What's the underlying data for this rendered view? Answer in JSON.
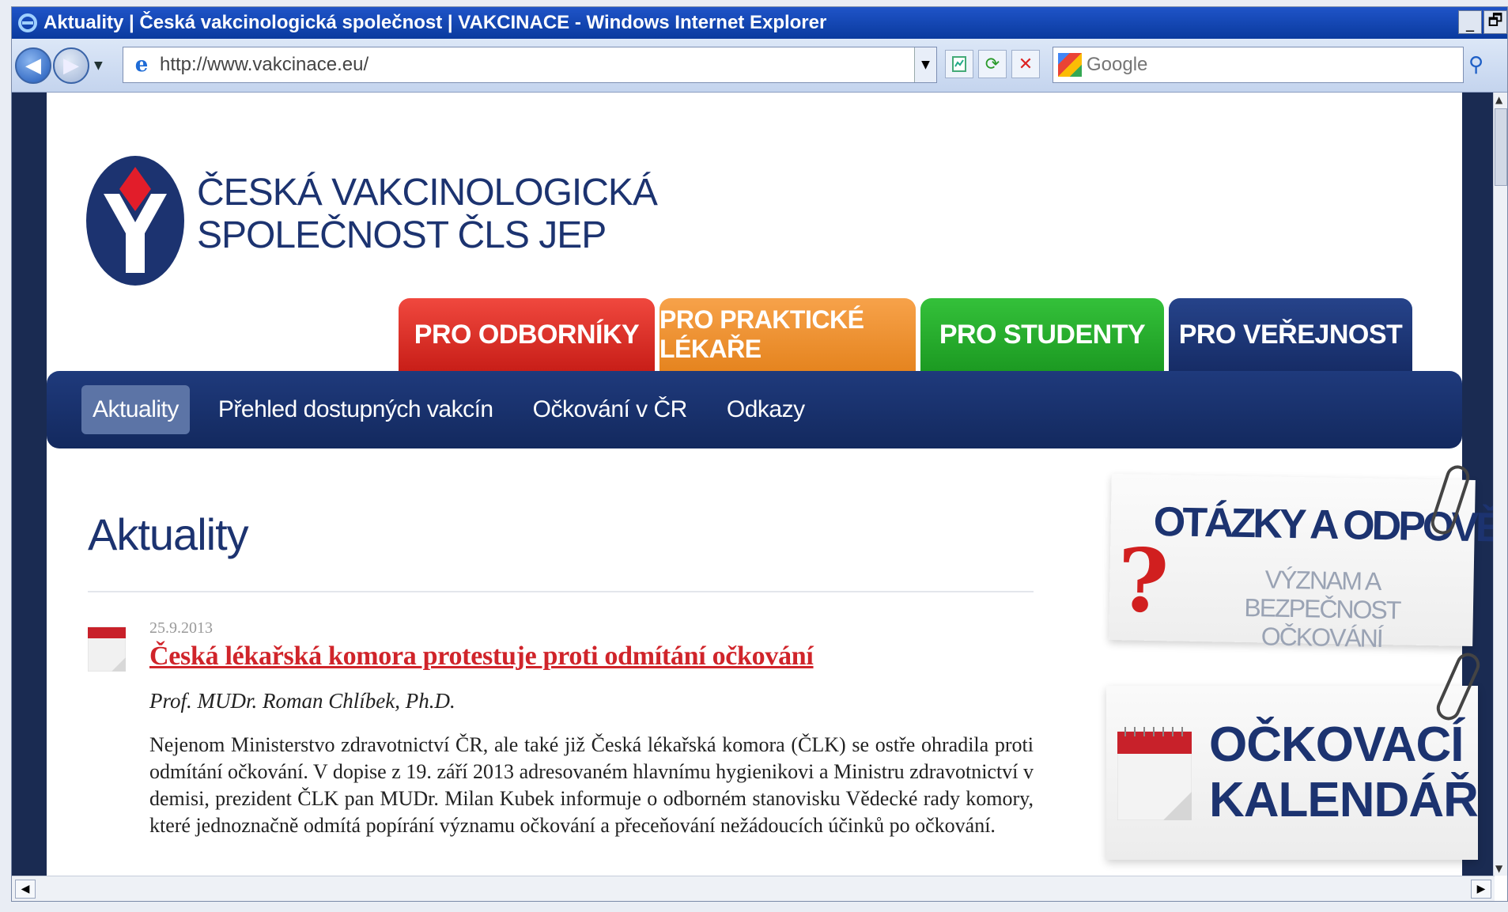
{
  "window": {
    "title": "Aktuality | Česká vakcinologická společnost | VAKCINACE - Windows Internet Explorer",
    "buttons": {
      "minimize": "_",
      "restore": "🗗"
    }
  },
  "toolbar": {
    "back_glyph": "◀",
    "forward_glyph": "▶",
    "history_glyph": "▼",
    "address": "http://www.vakcinace.eu/",
    "address_dropdown_glyph": "▼",
    "refresh_glyph": "⟳",
    "stop_glyph": "✕",
    "search_placeholder": "Google",
    "search_glyph": "⚲"
  },
  "site": {
    "brand_line1": "ČESKÁ VAKCINOLOGICKÁ",
    "brand_line2": "SPOLEČNOST ČLS JEP",
    "tabs": [
      {
        "label": "PRO ODBORNÍKY",
        "color": "#d92a22"
      },
      {
        "label": "PRO PRAKTICKÉ LÉKAŘE",
        "color": "#ef9330"
      },
      {
        "label": "PRO STUDENTY",
        "color": "#26ad2c"
      },
      {
        "label": "PRO VEŘEJNOST",
        "color": "#1c3370"
      }
    ],
    "subnav": [
      {
        "label": "Aktuality",
        "active": true
      },
      {
        "label": "Přehled dostupných vakcín",
        "active": false
      },
      {
        "label": "Očkování v ČR",
        "active": false
      },
      {
        "label": "Odkazy",
        "active": false
      }
    ]
  },
  "content": {
    "heading": "Aktuality",
    "article": {
      "date": "25.9.2013",
      "title": "Česká lékařská komora protestuje proti odmítání očkování",
      "author": "Prof. MUDr. Roman Chlíbek, Ph.D.",
      "body": "Nejenom Ministerstvo zdravotnictví ČR, ale také již Česká lékařská komora (ČLK) se ostře ohradila proti odmítání očkování. V dopise z 19. září 2013 adresovaném hlavnímu hygienikovi a Ministru zdravotnictví v demisi, prezident ČLK pan MUDr. Milan Kubek informuje o odborném stanovisku Vědecké rady komory, které jednoznačně odmítá popírání významu očkování a přeceňování nežádoucích účinků po očkování."
    }
  },
  "promos": {
    "qa_title": "OTÁZKY A ODPOVĚDI",
    "qa_subtitle_line1": "VÝZNAM A BEZPEČNOST",
    "qa_subtitle_line2": "OČKOVÁNÍ",
    "qa_glyph": "?",
    "calendar_line1": "OČKOVACÍ",
    "calendar_line2": "KALENDÁŘ"
  },
  "colors": {
    "brand_navy": "#1c3370",
    "article_link": "#d0242a",
    "titlebar": "#0a3a9e"
  }
}
